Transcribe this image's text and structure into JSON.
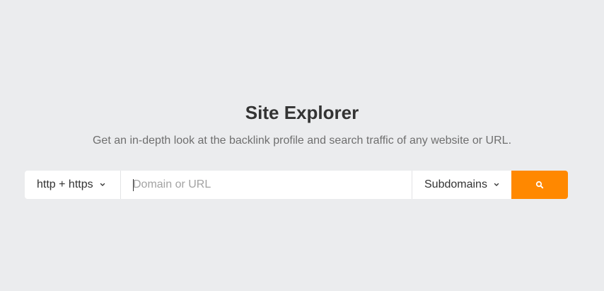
{
  "header": {
    "title": "Site Explorer",
    "subtitle": "Get an in-depth look at the backlink profile and search traffic of any website or URL."
  },
  "search": {
    "protocol_selected": "http + https",
    "url_value": "",
    "url_placeholder": "Domain or URL",
    "scope_selected": "Subdomains",
    "button_icon": "search-icon"
  },
  "colors": {
    "background": "#ebecee",
    "accent": "#ff8800",
    "title": "#333333",
    "subtitle": "#6f6f6f",
    "placeholder": "#a3a3a3"
  }
}
